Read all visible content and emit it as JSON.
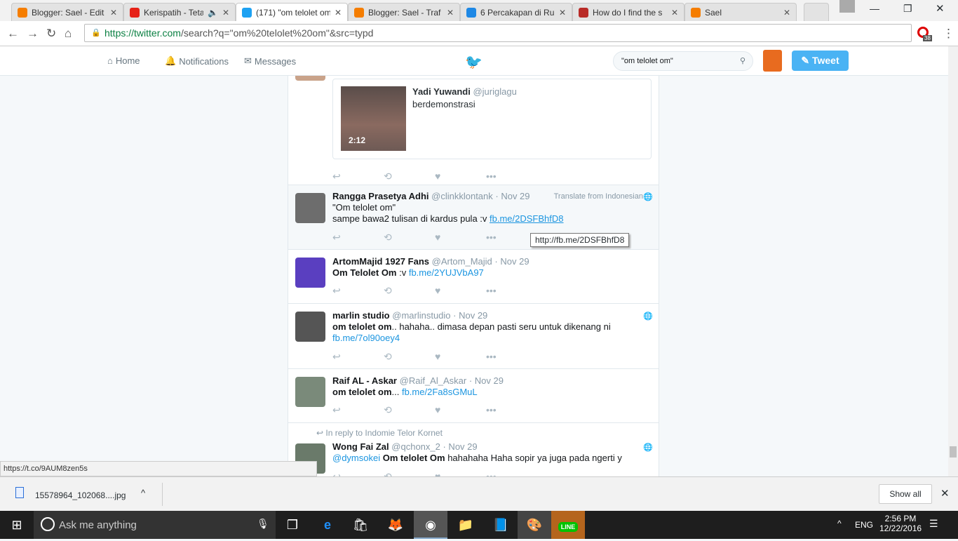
{
  "browser": {
    "tabs": [
      {
        "title": "Blogger: Sael - Edit",
        "icon": "blogger-icon",
        "color": "#f57d00"
      },
      {
        "title": "Kerispatih - Teta",
        "icon": "youtube-icon",
        "color": "#e62117",
        "audio": "speaker-icon"
      },
      {
        "title": "(171) \"om telolet om\"",
        "icon": "twitter-icon",
        "color": "#1da1f2",
        "active": true
      },
      {
        "title": "Blogger: Sael - Traf",
        "icon": "blogger-icon",
        "color": "#f57d00"
      },
      {
        "title": "6 Percakapan di Ru",
        "icon": "site-icon",
        "color": "#1e88e5"
      },
      {
        "title": "How do I find the s",
        "icon": "quora-icon",
        "color": "#b92b27"
      },
      {
        "title": "Sael",
        "icon": "m-icon",
        "color": "#f57d00"
      }
    ],
    "url_host": "https://twitter.com",
    "url_path": "/search?q=\"om%20telolet%20om\"&src=typd",
    "ext_badge": "38",
    "status_url": "https://t.co/9AUM8zen5s"
  },
  "twitter": {
    "nav": {
      "home": "Home",
      "notifications": "Notifications",
      "messages": "Messages"
    },
    "search_value": "\"om telolet om\"",
    "tweet_button": "Tweet",
    "brand": "#1da1f2"
  },
  "tweets": {
    "embed": {
      "name": "Yadi Yuwandi",
      "handle": "@juriglagu",
      "text": "berdemonstrasi",
      "duration": "2:12"
    },
    "t1": {
      "name": "Rangga Prasetya Adhi",
      "handle": "@clinkklontank",
      "date": "· Nov 29",
      "translate": "Translate from Indonesian",
      "line1": "\"Om telolet om\"",
      "line2": "sampe bawa2 tulisan di kardus pula :v ",
      "link": "fb.me/2DSFBhfD8",
      "tooltip": "http://fb.me/2DSFBhfD8"
    },
    "t2": {
      "name": "ArtomMajid 1927 Fans",
      "handle": "@Artom_Majid",
      "date": "· Nov 29",
      "bold": "Om Telolet Om",
      "text": " :v ",
      "link": "fb.me/2YUJVbA97"
    },
    "t3": {
      "name": "marlin studio",
      "handle": "@marlinstudio",
      "date": "· Nov 29",
      "bold": "om telolet om",
      "text": ".. hahaha.. dimasa depan pasti seru untuk dikenang ni",
      "link": "fb.me/7ol90oey4"
    },
    "t4": {
      "name": "Raif AL - Askar",
      "handle": "@Raif_Al_Askar",
      "date": "· Nov 29",
      "bold": "om telolet om",
      "text": "... ",
      "link": "fb.me/2Fa8sGMuL"
    },
    "t5": {
      "reply": "In reply to Indomie Telor Kornet",
      "name": "Wong Fai Zal",
      "handle": "@qchonx_2",
      "date": "· Nov 29",
      "mention": "@dymsokei",
      "bold": " Om telolet Om",
      "text": " hahahaha Haha sopir ya juga pada ngerti y"
    }
  },
  "downloads": {
    "file": "15578964_102068....jpg",
    "show_all": "Show all"
  },
  "taskbar": {
    "search": "Ask me anything",
    "lang": "ENG",
    "time": "2:56 PM",
    "date": "12/22/2016"
  }
}
